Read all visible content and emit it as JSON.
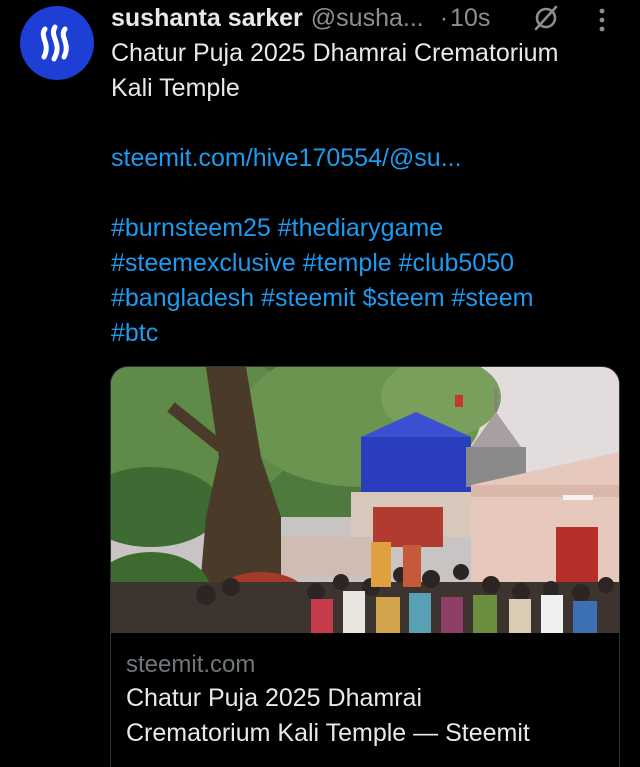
{
  "tweet": {
    "author_name": "sushanta sarker",
    "author_handle": "@susha...",
    "separator": "·",
    "timestamp": "10s",
    "avatar_icon": "steem-logo-icon",
    "avatar_color": "#1d3fd6",
    "text_lines": [
      "Chatur Puja 2025 Dhamrai Crematorium",
      "Kali Temple"
    ],
    "link_text": "steemit.com/hive170554/@su...",
    "hashtag_lines": [
      "#burnsteem25 #thediarygame",
      "#steemexclusive #temple #club5050",
      "#bangladesh #steemit $steem #steem",
      "#btc"
    ],
    "link_color": "#1d9bf0"
  },
  "card": {
    "domain": "steemit.com",
    "title_lines": [
      "Chatur Puja 2025 Dhamrai",
      "Crematorium Kali Temple — Steemit"
    ],
    "image_alt": "crowd at temple gate under large tree"
  }
}
